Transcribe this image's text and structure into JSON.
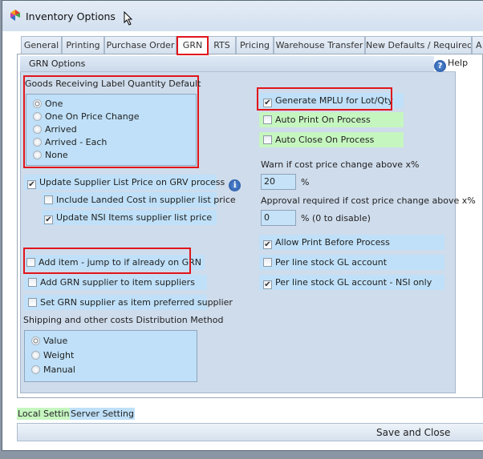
{
  "window": {
    "title": "Inventory Options",
    "app_icon": "app-logo-icon"
  },
  "tabs": [
    {
      "label": "General"
    },
    {
      "label": "Printing"
    },
    {
      "label": "Purchase Order"
    },
    {
      "label": "GRN",
      "selected": true
    },
    {
      "label": "RTS"
    },
    {
      "label": "Pricing"
    },
    {
      "label": "Warehouse Transfer"
    },
    {
      "label": "New Defaults / Required"
    },
    {
      "label": "A"
    }
  ],
  "group": {
    "title": "GRN Options",
    "help": "Help"
  },
  "label_qty": {
    "title": "Goods Receiving Label Quantity Default",
    "options": [
      "One",
      "One On Price Change",
      "Arrived",
      "Arrived - Each",
      "None"
    ],
    "selected": "One"
  },
  "left_checks": [
    {
      "label": "Update Supplier List Price on GRV process",
      "checked": true
    },
    {
      "label": "Include Landed Cost in supplier list price",
      "checked": false
    },
    {
      "label": "Update NSI Items supplier list price",
      "checked": true
    },
    {
      "label": "Add item - jump to if already on GRN",
      "checked": false
    },
    {
      "label": "Add GRN supplier to item suppliers",
      "checked": false
    },
    {
      "label": "Set GRN supplier as item preferred supplier",
      "checked": false
    }
  ],
  "distribution": {
    "title": "Shipping and other costs Distribution Method",
    "options": [
      "Value",
      "Weight",
      "Manual"
    ],
    "selected": "Value"
  },
  "right_checks": [
    {
      "label": "Generate MPLU for Lot/Qty",
      "checked": true
    },
    {
      "label": "Auto Print On Process",
      "checked": false
    },
    {
      "label": "Auto Close On Process",
      "checked": false
    },
    {
      "label": "Allow Print Before Process",
      "checked": true
    },
    {
      "label": "Per line stock GL account",
      "checked": false
    },
    {
      "label": "Per line stock GL account - NSI only",
      "checked": true
    }
  ],
  "warn": {
    "label": "Warn if cost price change above x%",
    "value": "20",
    "suffix": "%"
  },
  "approval": {
    "label": "Approval required if cost price change above x%",
    "value": "0",
    "suffix": "% (0 to disable)"
  },
  "legend": {
    "local": "Local Setting",
    "server": "Server Setting"
  },
  "colors": {
    "local": "#c6f6c0",
    "server": "#bfe0f8",
    "highlight": "#e0161b"
  },
  "save_label": "Save and Close"
}
